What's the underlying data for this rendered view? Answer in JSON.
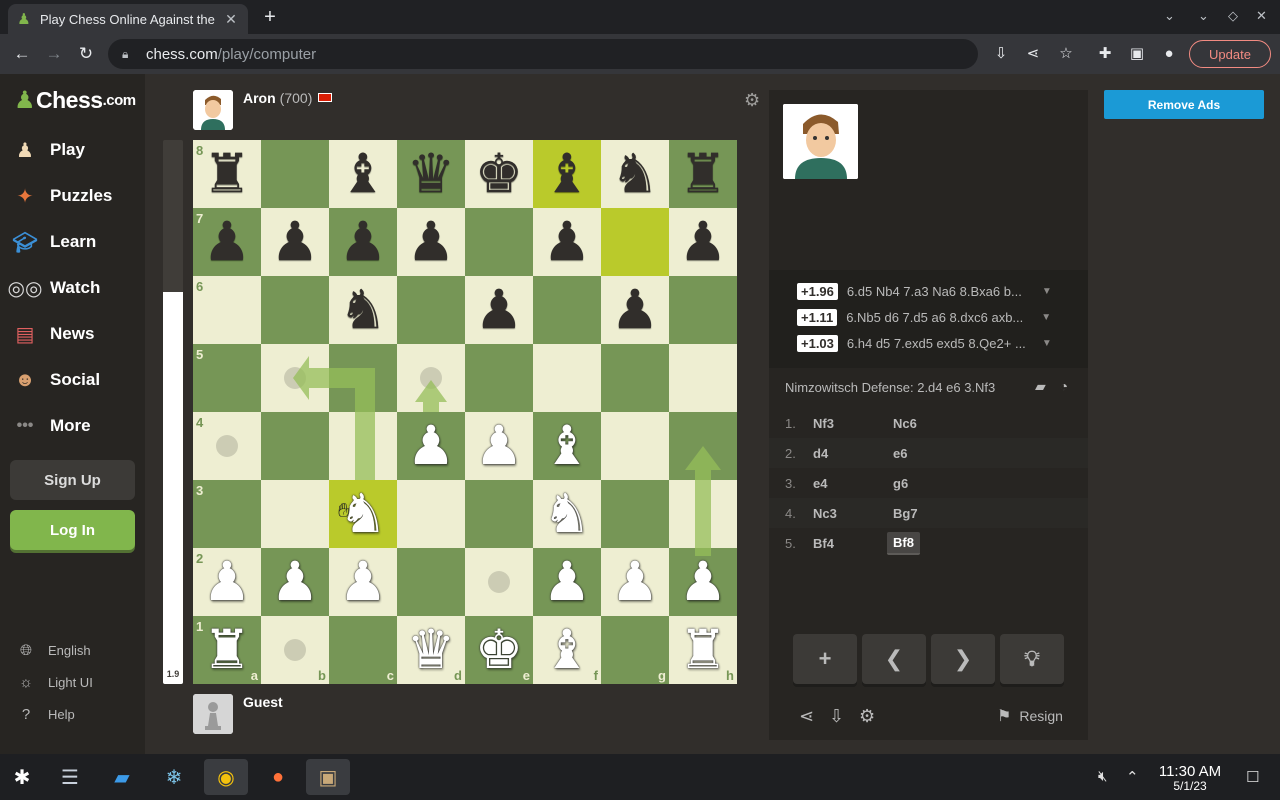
{
  "browser": {
    "tab_title": "Play Chess Online Against the",
    "url_host": "chess.com",
    "url_path": "/play/computer",
    "update_label": "Update"
  },
  "sidebar": {
    "logo_text": "Chess",
    "logo_suffix": ".com",
    "nav": [
      {
        "label": "Play",
        "icon": "play-pawn-icon"
      },
      {
        "label": "Puzzles",
        "icon": "puzzle-icon"
      },
      {
        "label": "Learn",
        "icon": "graduation-cap-icon"
      },
      {
        "label": "Watch",
        "icon": "binoculars-icon"
      },
      {
        "label": "News",
        "icon": "newspaper-icon"
      },
      {
        "label": "Social",
        "icon": "people-icon"
      },
      {
        "label": "More",
        "icon": "more-dots-icon"
      }
    ],
    "signup_label": "Sign Up",
    "login_label": "Log In",
    "footer": [
      {
        "label": "English",
        "icon": "globe-icon"
      },
      {
        "label": "Light UI",
        "icon": "sun-icon"
      },
      {
        "label": "Help",
        "icon": "help-icon"
      }
    ]
  },
  "opponent": {
    "name": "Aron",
    "rating": "(700)"
  },
  "player": {
    "name": "Guest"
  },
  "eval": {
    "score": "1.9",
    "white_fraction": 0.72
  },
  "board": {
    "ranks": [
      "8",
      "7",
      "6",
      "5",
      "4",
      "3",
      "2",
      "1"
    ],
    "files": [
      "a",
      "b",
      "c",
      "d",
      "e",
      "f",
      "g",
      "h"
    ],
    "rows": [
      [
        "r",
        "",
        "b",
        "q",
        "k",
        "b",
        "n",
        "r"
      ],
      [
        "p",
        "p",
        "p",
        "p",
        "",
        "p",
        "",
        "p"
      ],
      [
        "",
        "",
        "n",
        "",
        "p",
        "",
        "p",
        ""
      ],
      [
        "",
        "",
        "",
        "",
        "",
        "",
        "",
        ""
      ],
      [
        "",
        "",
        "",
        "P",
        "P",
        "B",
        "",
        ""
      ],
      [
        "",
        "",
        "N",
        "",
        "",
        "N",
        "",
        ""
      ],
      [
        "P",
        "P",
        "P",
        "",
        "",
        "P",
        "P",
        "P"
      ],
      [
        "R",
        "",
        "",
        "Q",
        "K",
        "B",
        "",
        "R"
      ]
    ],
    "highlights": [
      "f8",
      "g7",
      "c3"
    ],
    "hints": [
      "b5",
      "d5",
      "a4",
      "e2",
      "b1"
    ]
  },
  "engine_lines": [
    {
      "score": "+1.96",
      "line": "6.d5 Nb4 7.a3 Na6 8.Bxa6 b..."
    },
    {
      "score": "+1.11",
      "line": "6.Nb5 d6 7.d5 a6 8.dxc6 axb..."
    },
    {
      "score": "+1.03",
      "line": "6.h4 d5 7.exd5 exd5 8.Qe2+ ..."
    }
  ],
  "opening": "Nimzowitsch Defense: 2.d4 e6 3.Nf3",
  "moves": [
    {
      "num": "1.",
      "white": "Nf3",
      "black": "Nc6"
    },
    {
      "num": "2.",
      "white": "d4",
      "black": "e6"
    },
    {
      "num": "3.",
      "white": "e4",
      "black": "g6"
    },
    {
      "num": "4.",
      "white": "Nc3",
      "black": "Bg7"
    },
    {
      "num": "5.",
      "white": "Bf4",
      "black": "Bf8"
    }
  ],
  "controls": {
    "resign_label": "Resign",
    "remove_ads_label": "Remove Ads"
  },
  "taskbar": {
    "time": "11:30 AM",
    "date": "5/1/23"
  },
  "colors": {
    "accent_green": "#81b64c",
    "board_light": "#eeeed2",
    "board_dark": "#769656",
    "remove_ads_blue": "#1b9ad6"
  }
}
